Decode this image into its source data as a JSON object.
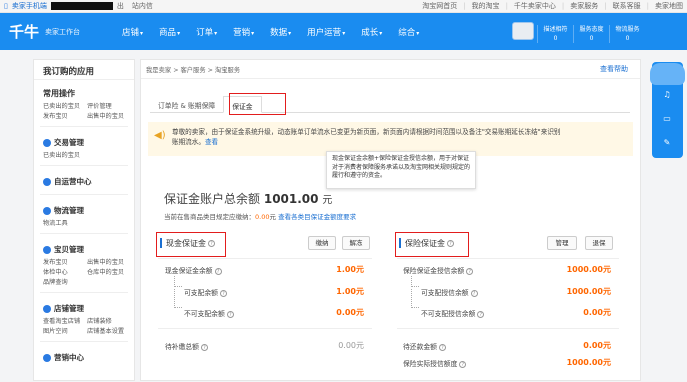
{
  "topbar": {
    "left_label": "卖家手机端",
    "user_suffix": "出",
    "mailbox": "站内信",
    "links": [
      "淘宝网首页",
      "我的淘宝",
      "千牛卖家中心",
      "卖家服务",
      "联系客服",
      "卖家地图"
    ]
  },
  "nav": {
    "logo": "千牛",
    "logo_sub": "卖家工作台",
    "menu": [
      "店铺",
      "商品",
      "订单",
      "营销",
      "数据",
      "用户运营",
      "成长",
      "综合"
    ],
    "stats": [
      {
        "label": "描述相符",
        "value": "0"
      },
      {
        "label": "服务态度",
        "value": "0"
      },
      {
        "label": "物流服务",
        "value": "0"
      }
    ]
  },
  "sidebar": {
    "title": "我订购的应用",
    "common": {
      "title": "常用操作",
      "rows": [
        [
          "已卖出的宝贝",
          "评价管理"
        ],
        [
          "发布宝贝",
          "出售中的宝贝"
        ]
      ]
    },
    "groups": [
      {
        "title": "交易管理",
        "rows": [
          [
            "已卖出的宝贝",
            ""
          ]
        ]
      },
      {
        "title": "自运营中心",
        "rows": []
      },
      {
        "title": "物流管理",
        "rows": [
          [
            "物流工具",
            ""
          ]
        ]
      },
      {
        "title": "宝贝管理",
        "rows": [
          [
            "发布宝贝",
            "出售中的宝贝"
          ],
          [
            "体检中心",
            "仓库中的宝贝"
          ],
          [
            "品牌查询",
            ""
          ]
        ]
      },
      {
        "title": "店铺管理",
        "rows": [
          [
            "查看淘宝店铺",
            "店铺装修"
          ],
          [
            "图片空间",
            "店铺基本设置"
          ]
        ]
      },
      {
        "title": "营销中心",
        "rows": []
      }
    ]
  },
  "main": {
    "breadcrumb": "我是卖家 > 客户服务 > 淘宝服务",
    "help": "查看帮助",
    "tabs": [
      "订单险 & 账期保障",
      "保证金"
    ],
    "notice": {
      "text": "尊敬的卖家，由于保证金系统升级，动态账单订单流水已变更为新页面，新页面内请根据时间范围以及备注\"交易账期延长冻结\"来识别账期流水。",
      "link": "查看"
    },
    "tooltip": "现金保证金余额+保险保证金授信余额，用于对保证对于消费者保障服务承诺以及淘宝网相关规则规定的履行和遵守的资金。",
    "total": {
      "label": "保证金账户总余额",
      "amount": "1001.00",
      "unit": "元"
    },
    "sub": {
      "prefix": "当前在售商品类目规定应缴纳：",
      "amount": "0.00",
      "unit": "元",
      "link": "查看各类目保证金额度要求"
    },
    "cash": {
      "title": "现金保证金",
      "buttons": [
        "缴纳",
        "解冻"
      ],
      "rows": [
        {
          "label": "现金保证金余额",
          "value": "1.00元"
        },
        {
          "label": "可支配余额",
          "value": "1.00元"
        },
        {
          "label": "不可支配余额",
          "value": "0.00元"
        },
        {
          "label": "待补缴总额",
          "value": "0.00元"
        }
      ]
    },
    "insurance": {
      "title": "保险保证金",
      "buttons": [
        "管理",
        "退保"
      ],
      "rows": [
        {
          "label": "保险保证金授信余额",
          "value": "1000.00元"
        },
        {
          "label": "可支配授信余额",
          "value": "1000.00元"
        },
        {
          "label": "不可支配授信余额",
          "value": "0.00元"
        },
        {
          "label": "待还款金额",
          "value": "0.00元"
        },
        {
          "label": "保险实际授信额度",
          "value": "1000.00元"
        }
      ]
    }
  },
  "colors": {
    "nav": "#1a8cf0",
    "accent": "#f60",
    "highlight": "#e21d1d"
  }
}
